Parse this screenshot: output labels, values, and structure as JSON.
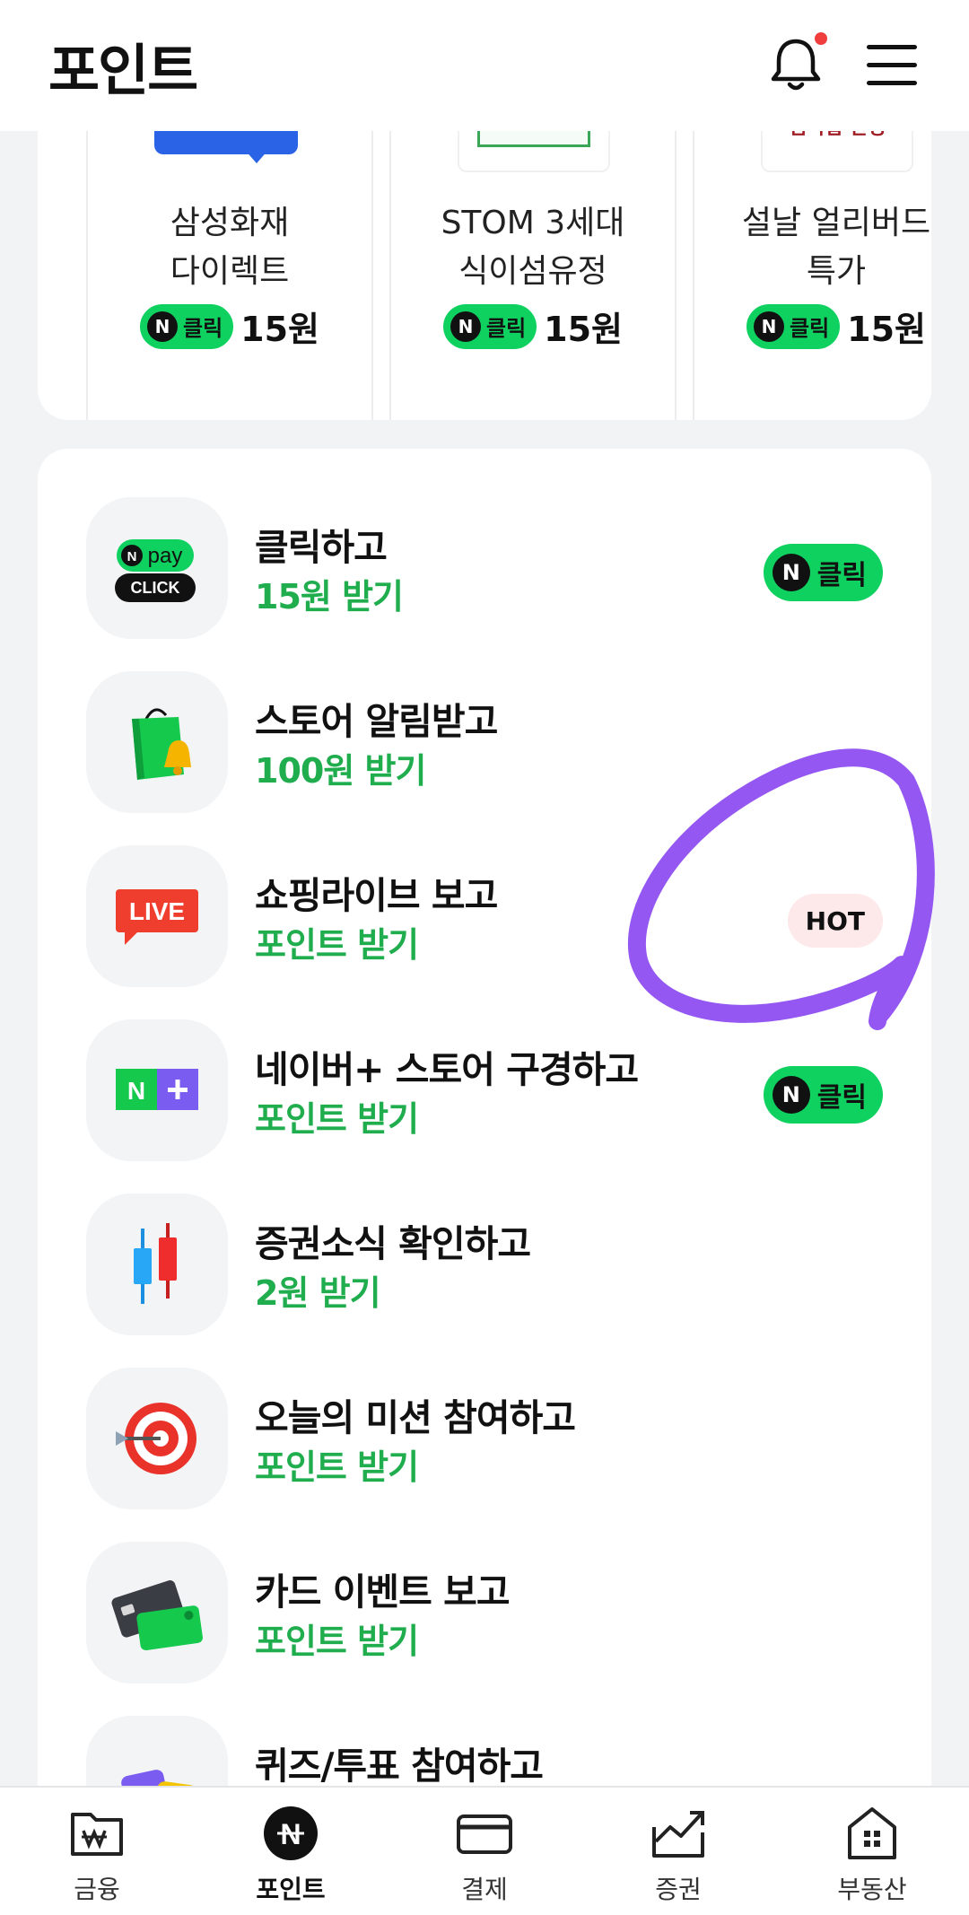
{
  "header": {
    "title": "포인트"
  },
  "ads": [
    {
      "name_line1": "삼성화재",
      "name_line2": "다이렉트",
      "badge": "클릭",
      "price": "15원"
    },
    {
      "name_line1": "STOM 3세대",
      "name_line2": "식이섬유정",
      "badge": "클릭",
      "price": "15원"
    },
    {
      "name_line1": "설날 얼리버드",
      "name_line2": "특가",
      "badge": "클릭",
      "price": "15원",
      "thumb_text": "멤버십 한정"
    }
  ],
  "tasks": [
    {
      "title": "클릭하고",
      "subtitle": "15원 받기",
      "action": "클릭",
      "icon": "npay-click-icon",
      "icon_text_top": "pay",
      "icon_text_bottom": "CLICK"
    },
    {
      "title": "스토어 알림받고",
      "subtitle": "100원 받기",
      "icon": "shopping-bag-bell-icon"
    },
    {
      "title": "쇼핑라이브 보고",
      "subtitle": "포인트 받기",
      "badge": "HOT",
      "icon": "live-icon",
      "icon_text": "LIVE"
    },
    {
      "title": "네이버+ 스토어 구경하고",
      "subtitle": "포인트 받기",
      "action": "클릭",
      "icon": "naver-plus-icon"
    },
    {
      "title": "증권소식 확인하고",
      "subtitle": "2원 받기",
      "icon": "candlestick-icon"
    },
    {
      "title": "오늘의 미션 참여하고",
      "subtitle": "포인트 받기",
      "icon": "target-icon"
    },
    {
      "title": "카드 이벤트 보고",
      "subtitle": "포인트 받기",
      "icon": "card-icon"
    },
    {
      "title": "퀴즈/투표 참여하고",
      "subtitle": "",
      "icon": "quiz-icon"
    }
  ],
  "bottom_nav": [
    {
      "label": "금융",
      "icon": "finance-folder-icon"
    },
    {
      "label": "포인트",
      "icon": "point-icon",
      "active": true
    },
    {
      "label": "결제",
      "icon": "card-payment-icon"
    },
    {
      "label": "증권",
      "icon": "stock-chart-icon"
    },
    {
      "label": "부동산",
      "icon": "real-estate-icon"
    }
  ],
  "colors": {
    "accent_green": "#0fd160",
    "text_green": "#1fad4e",
    "annotation_purple": "#9457f2",
    "hot_bg": "#fde8ea"
  }
}
